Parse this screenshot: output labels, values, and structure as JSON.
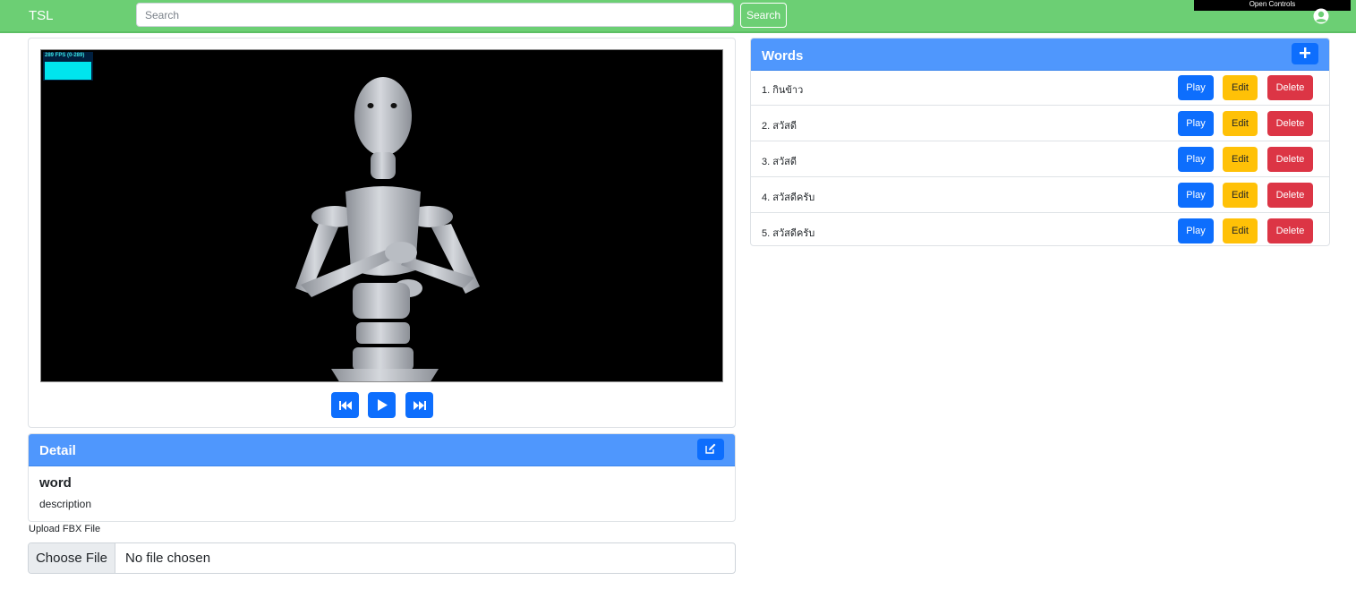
{
  "navbar": {
    "brand": "TSL",
    "search_placeholder": "Search",
    "search_button": "Search",
    "open_controls": "Open Controls",
    "user_icon": "user-circle-icon",
    "color": "#6ccf74"
  },
  "viewer": {
    "fps_text": "289 FPS (0-289)",
    "controls": [
      "skip-back-icon",
      "play-icon",
      "skip-forward-icon"
    ]
  },
  "detail": {
    "header": "Detail",
    "edit_icon": "edit-icon",
    "word": "word",
    "description": "description"
  },
  "upload": {
    "label": "Upload FBX File",
    "button": "Choose File",
    "status": "No file chosen"
  },
  "words": {
    "header": "Words",
    "add_icon": "plus-icon",
    "items": [
      {
        "label": "1. กินข้าว",
        "play": "Play",
        "edit": "Edit",
        "delete": "Delete"
      },
      {
        "label": "2. สวัสดี",
        "play": "Play",
        "edit": "Edit",
        "delete": "Delete"
      },
      {
        "label": "3. สวัสดี",
        "play": "Play",
        "edit": "Edit",
        "delete": "Delete"
      },
      {
        "label": "4. สวัสดีครับ",
        "play": "Play",
        "edit": "Edit",
        "delete": "Delete"
      },
      {
        "label": "5. สวัสดีครับ",
        "play": "Play",
        "edit": "Edit",
        "delete": "Delete"
      }
    ]
  },
  "colors": {
    "primary": "#0d6efd",
    "header": "#4f97fd",
    "warning": "#ffc107",
    "danger": "#dc3545"
  }
}
